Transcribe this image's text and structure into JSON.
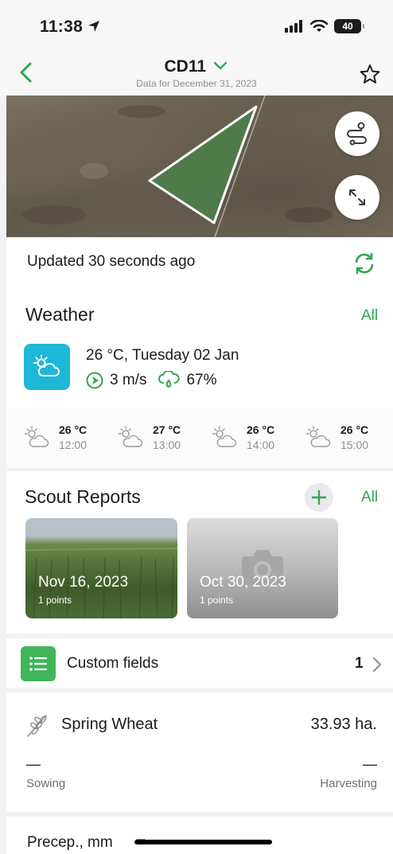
{
  "status_bar": {
    "time": "11:38",
    "battery": "40"
  },
  "nav": {
    "title": "CD11",
    "subtitle": "Data for December 31, 2023"
  },
  "map": {
    "field_color": "#4f7a4a"
  },
  "updated": {
    "text": "Updated 30 seconds ago"
  },
  "weather": {
    "title": "Weather",
    "all_label": "All",
    "current": "26 °C, Tuesday 02 Jan",
    "wind": "3 m/s",
    "precipitation": "67%",
    "forecast": [
      {
        "temp": "26 °C",
        "time": "12:00"
      },
      {
        "temp": "27 °C",
        "time": "13:00"
      },
      {
        "temp": "26 °C",
        "time": "14:00"
      },
      {
        "temp": "26 °C",
        "time": "15:00"
      }
    ]
  },
  "scout": {
    "title": "Scout Reports",
    "all_label": "All",
    "reports": [
      {
        "date": "Nov 16, 2023",
        "points": "1 points"
      },
      {
        "date": "Oct 30, 2023",
        "points": "1 points"
      }
    ]
  },
  "custom_fields": {
    "label": "Custom fields",
    "count": "1"
  },
  "crop": {
    "name": "Spring Wheat",
    "area": "33.93 ha.",
    "sowing_value": "—",
    "sowing_label": "Sowing",
    "harvest_value": "—",
    "harvest_label": "Harvesting"
  },
  "precip_section": {
    "label": "Precep., mm"
  },
  "colors": {
    "accent": "#2fa84f",
    "weather_tile": "#1fb7d8",
    "custom_fields_tile": "#3fb55a"
  }
}
